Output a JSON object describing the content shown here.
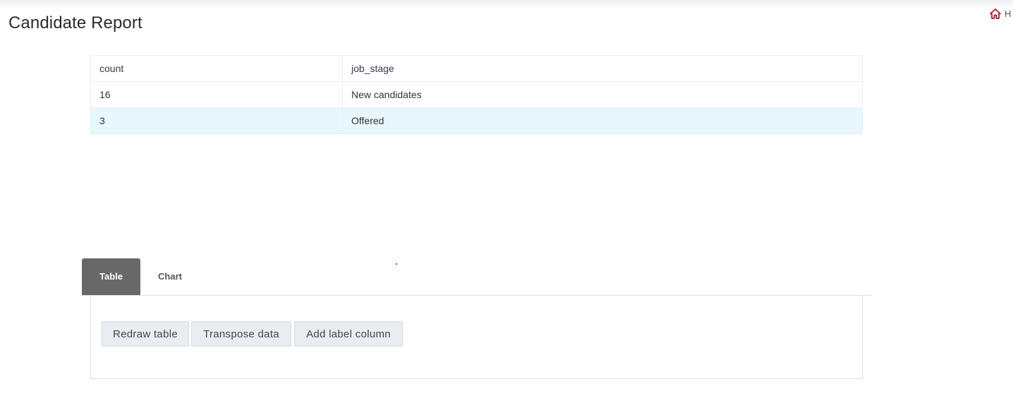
{
  "header": {
    "title": "Candidate Report",
    "home_label": "H"
  },
  "colors": {
    "home_icon": "#a8182b",
    "active_tab": "#686868",
    "selected_row": "#e8f7fd"
  },
  "table": {
    "headers": [
      "count",
      "job_stage"
    ],
    "rows": [
      [
        "16",
        "New candidates"
      ],
      [
        "3",
        "Offered"
      ]
    ]
  },
  "tabs": [
    {
      "label": "Table",
      "active": true
    },
    {
      "label": "Chart",
      "active": false
    }
  ],
  "actions": {
    "redraw": "Redraw table",
    "transpose": "Transpose data",
    "add_label": "Add label column"
  }
}
